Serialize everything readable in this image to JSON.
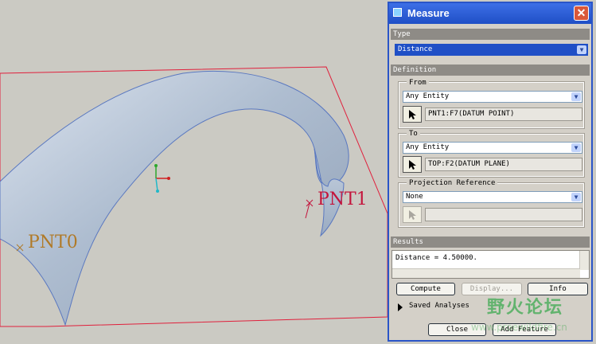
{
  "viewport": {
    "point_labels": [
      "PNT0",
      "PNT1"
    ]
  },
  "dialog": {
    "title": "Measure",
    "close_glyph": "✕",
    "sections": {
      "type": "Type",
      "definition": "Definition",
      "results": "Results"
    },
    "type_select": "Distance",
    "from": {
      "label": "From",
      "filter": "Any Entity",
      "selection": "PNT1:F7(DATUM POINT)"
    },
    "to": {
      "label": "To",
      "filter": "Any Entity",
      "selection": "TOP:F2(DATUM PLANE)"
    },
    "projection": {
      "label": "Projection Reference",
      "filter": "None",
      "selection": ""
    },
    "result_text": "Distance = 4.50000.",
    "buttons": {
      "compute": "Compute",
      "display": "Display...",
      "info": "Info",
      "close": "Close",
      "add_feature": "Add Feature"
    },
    "saved_analyses": "Saved Analyses"
  },
  "watermark": {
    "text": "野火论坛",
    "url": "www.proewildfire.cn"
  },
  "colors": {
    "background": "#cbcac3",
    "surface": "#b3c2d6",
    "datum_plane": "#e0203c",
    "title_bar": "#2a55c8"
  },
  "icons": [
    "select-arrow-icon",
    "dropdown-arrow-icon",
    "close-icon",
    "expand-arrow-icon",
    "coordinate-axes-icon"
  ]
}
